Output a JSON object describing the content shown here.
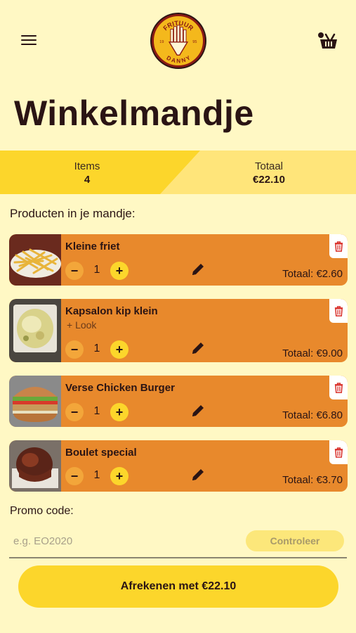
{
  "header": {
    "menu_icon": "hamburger-menu-icon",
    "logo_text_top": "FRITUUR",
    "logo_text_bottom": "DANNY",
    "logo_year_left": "19",
    "logo_year_right": "95",
    "basket_icon": "basket-icon"
  },
  "page": {
    "title": "Winkelmandje"
  },
  "summary": {
    "items_label": "Items",
    "items_value": "4",
    "total_label": "Totaal",
    "total_value": "€22.10"
  },
  "section_label": "Producten in je mandje:",
  "cart": [
    {
      "name": "Kleine friet",
      "extra": "",
      "quantity": "1",
      "total": "Totaal: €2.60",
      "thumb": "fries-photo"
    },
    {
      "name": "Kapsalon kip klein",
      "extra": "+ Look",
      "quantity": "1",
      "total": "Totaal: €9.00",
      "thumb": "kapsalon-photo"
    },
    {
      "name": "Verse Chicken Burger",
      "extra": "",
      "quantity": "1",
      "total": "Totaal: €6.80",
      "thumb": "burger-photo"
    },
    {
      "name": "Boulet special",
      "extra": "",
      "quantity": "1",
      "total": "Totaal: €3.70",
      "thumb": "boulet-photo"
    }
  ],
  "controls": {
    "minus": "−",
    "plus": "+"
  },
  "promo": {
    "label": "Promo code:",
    "placeholder": "e.g. EO2020",
    "check_label": "Controleer"
  },
  "checkout": {
    "label": "Afrekenen met €22.10"
  },
  "colors": {
    "background": "#fff8c4",
    "accent_yellow": "#fcd62b",
    "item_orange": "#e8892c",
    "trash_red": "#d9302a"
  }
}
